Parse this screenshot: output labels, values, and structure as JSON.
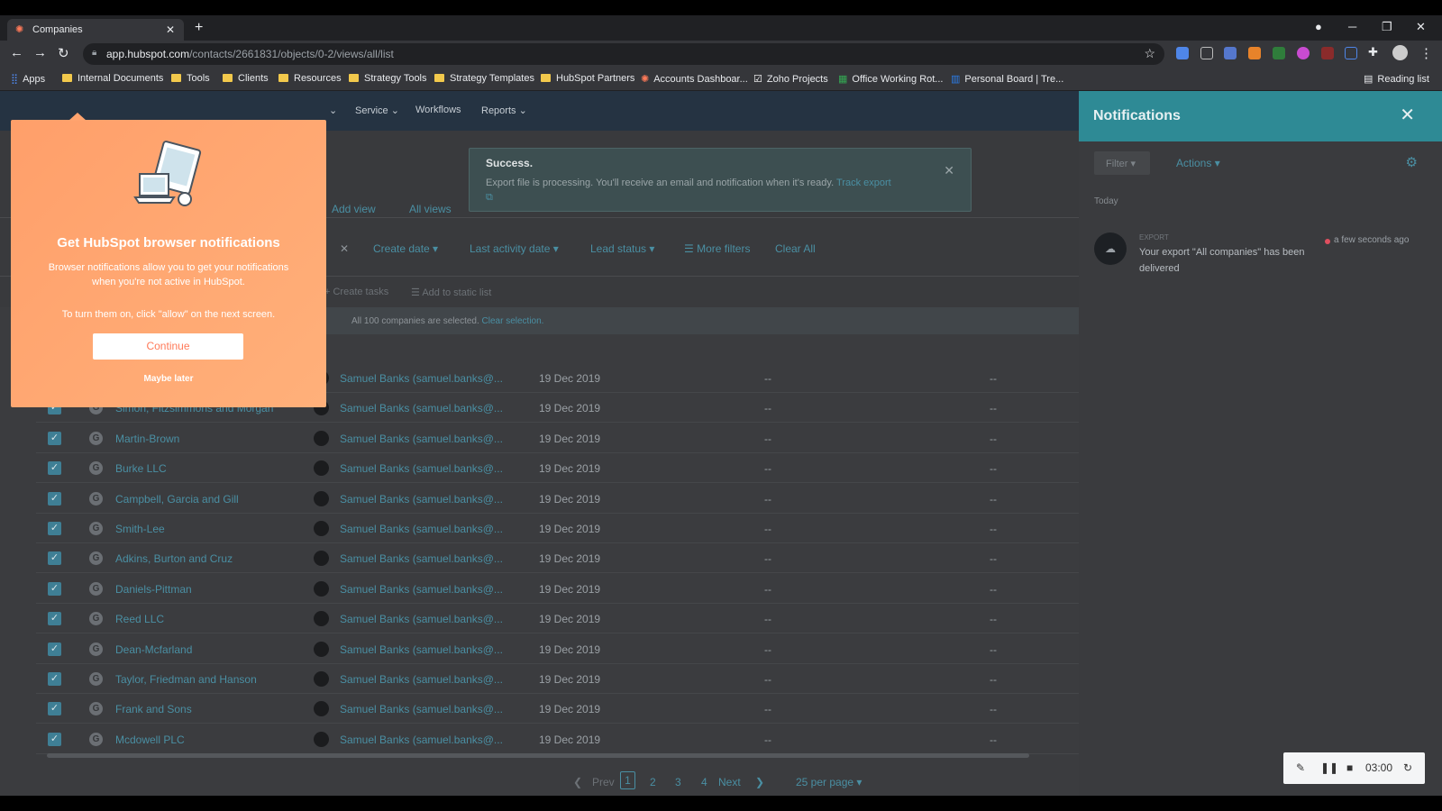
{
  "browser": {
    "tab_title": "Companies",
    "url_host": "app.hubspot.com",
    "url_path": "/contacts/2661831/objects/0-2/views/all/list",
    "bookmarks": [
      "Apps",
      "Internal Documents",
      "Tools",
      "Clients",
      "Resources",
      "Strategy Tools",
      "Strategy Templates",
      "HubSpot Partners",
      "Accounts Dashboar...",
      "Zoho Projects",
      "Office Working Rot...",
      "Personal Board | Tre..."
    ],
    "reading_list": "Reading list"
  },
  "topnav": {
    "items": [
      "Service",
      "Workflows",
      "Reports"
    ]
  },
  "toast": {
    "title": "Success.",
    "message": "Export file is processing. You'll receive an email and notification when it's ready.",
    "link": "Track export"
  },
  "views": {
    "add_view": "Add view",
    "all_views": "All views"
  },
  "filters": {
    "items": [
      "Create date",
      "Last activity date",
      "Lead status"
    ],
    "more": "More filters",
    "clear": "Clear All"
  },
  "bulk_actions": {
    "create_tasks": "Create tasks",
    "add_to_list": "Add to static list"
  },
  "selection": {
    "text": "All 100 companies are selected.",
    "link": "Clear selection."
  },
  "table": {
    "owner": "Samuel Banks (samuel.banks@...",
    "date": "19 Dec 2019",
    "empty": "--",
    "rows": [
      "",
      "Simon, Fitzsimmons and Morgan",
      "Martin-Brown",
      "Burke LLC",
      "Campbell, Garcia and Gill",
      "Smith-Lee",
      "Adkins, Burton and Cruz",
      "Daniels-Pittman",
      "Reed LLC",
      "Dean-Mcfarland",
      "Taylor, Friedman and Hanson",
      "Frank and Sons",
      "Mcdowell PLC"
    ]
  },
  "pagination": {
    "prev": "Prev",
    "pages": [
      "1",
      "2",
      "3",
      "4"
    ],
    "current": "1",
    "next": "Next",
    "per_page": "25 per page"
  },
  "popup": {
    "title": "Get HubSpot browser notifications",
    "body": "Browser notifications allow you to get your notifications when you're not active in HubSpot.",
    "instruction": "To turn them on, click \"allow\" on the next screen.",
    "continue": "Continue",
    "later": "Maybe later"
  },
  "notifications": {
    "title": "Notifications",
    "filter": "Filter",
    "actions": "Actions",
    "section": "Today",
    "item": {
      "kind": "EXPORT",
      "message": "Your export \"All companies\" has been delivered",
      "time": "a few seconds ago"
    },
    "recorder_time": "03:00"
  },
  "colors": {
    "accent": "#4a8fa3",
    "panel_header": "#2e8a95",
    "popup": "#ff9f6a"
  }
}
